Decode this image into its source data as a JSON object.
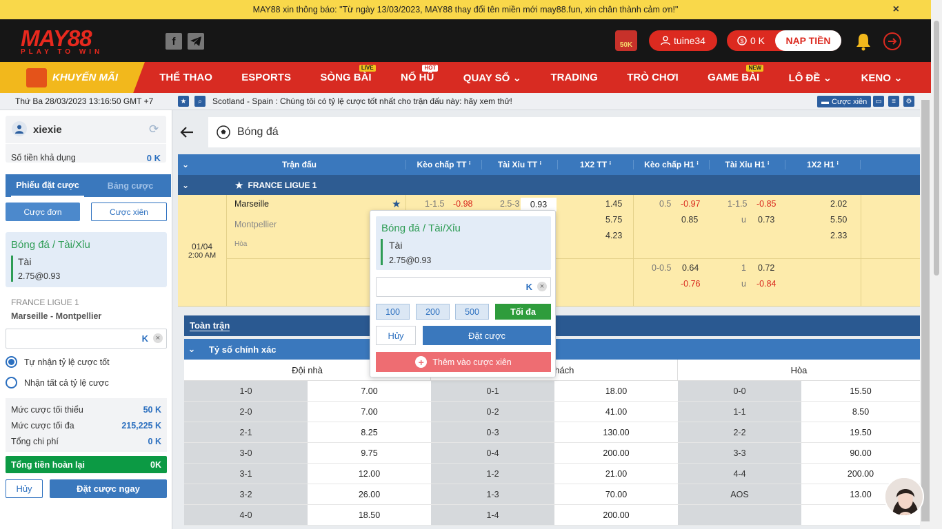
{
  "notice": {
    "text": "MAY88 xin thông báo: \"Từ ngày 13/03/2023, MAY88 thay đổi tên miền mới may88.fun, xin chân thành cảm ơn!\"",
    "close": "×"
  },
  "brand": {
    "name": "MAY88",
    "tagline": "PLAY TO WIN",
    "accent": "#dc2a20"
  },
  "header": {
    "promo_badge": "50K",
    "username": "tuine34",
    "balance": "0 K",
    "deposit_label": "NẠP TIỀN"
  },
  "nav": {
    "promo": "KHUYẾN MÃI",
    "items": [
      {
        "label": "THỂ THAO",
        "badge": ""
      },
      {
        "label": "ESPORTS",
        "badge": ""
      },
      {
        "label": "SÒNG BÀI",
        "badge": "LIVE"
      },
      {
        "label": "NỔ HŨ",
        "badge": "HOT"
      },
      {
        "label": "QUAY SỐ",
        "badge": ""
      },
      {
        "label": "TRADING",
        "badge": ""
      },
      {
        "label": "TRÒ CHƠI",
        "badge": ""
      },
      {
        "label": "GAME BÀI",
        "badge": "NEW"
      },
      {
        "label": "LÔ ĐỀ",
        "badge": ""
      },
      {
        "label": "KENO",
        "badge": ""
      }
    ]
  },
  "infobar": {
    "datetime": "Thứ Ba 28/03/2023 13:16:50 GMT +7",
    "ticker": "Scotland - Spain : Chúng tôi có tỷ lệ cược tốt nhất cho trận đấu này: hãy xem thử!",
    "parlay": "Cược xiên"
  },
  "sidebar": {
    "user": "xiexie",
    "available_label": "Số tiền khả dụng",
    "available_value": "0 K",
    "tab_active": "Phiếu đặt cược",
    "tab_other": "Bảng cược",
    "btn_single": "Cược đơn",
    "btn_parlay": "Cược xiên",
    "bet_market": "Bóng đá / Tài/Xỉu",
    "bet_pick": "Tài",
    "bet_odds": "2.75@0.93",
    "league": "FRANCE LIGUE 1",
    "match": "Marseille - Montpellier",
    "stake_unit": "K",
    "clear": "×",
    "opt1": "Tự nhận tỷ lệ cược tốt",
    "opt2": "Nhận tất cả tỷ lệ cược",
    "min_label": "Mức cược tối thiểu",
    "min_value": "50 K",
    "max_label": "Mức cược tối đa",
    "max_value": "215,225 K",
    "total_label": "Tổng chi phí",
    "total_value": "0 K",
    "refund_label": "Tổng tiền hoàn lại",
    "refund_value": "0K",
    "cancel": "Hủy",
    "place": "Đặt cược ngay"
  },
  "main": {
    "title": "Bóng đá",
    "columns": [
      "Trận đấu",
      "Kèo chấp TT",
      "Tài Xỉu TT",
      "1X2 TT",
      "Kèo chấp H1",
      "Tài Xỉu H1",
      "1X2 H1"
    ],
    "league": "FRANCE LIGUE 1",
    "match": {
      "date": "01/04",
      "time": "2:00 AM",
      "home": "Marseille",
      "away": "Montpellier",
      "draw": "Hòa",
      "hdp_tt_line": "1-1.5",
      "hdp_tt_odds": "-0.98",
      "ou_tt_line": "2.5-3",
      "ou_tt_odds": "0.93",
      "x12_tt": [
        "1.45",
        "5.75",
        "4.23"
      ],
      "hdp_h1_line": "0.5",
      "hdp_h1_odds1": "-0.97",
      "hdp_h1_odds2": "0.85",
      "ou_h1_line": "1-1.5",
      "ou_h1_odds1": "-0.85",
      "ou_h1_u": "u",
      "ou_h1_odds2": "0.73",
      "x12_h1": [
        "2.02",
        "5.50",
        "2.33"
      ],
      "alt_hdp_h1_line": "0-0.5",
      "alt_hdp_h1_odds1": "0.64",
      "alt_hdp_h1_odds2": "-0.76",
      "alt_ou_h1_line": "1",
      "alt_ou_h1_odds1": "0.72",
      "alt_ou_h1_u": "u",
      "alt_ou_h1_odds2": "-0.84"
    },
    "tab_full": "Toàn trận",
    "section": "Tỷ số chính xác",
    "cs_headers": [
      "Đội nhà",
      "Đội khách",
      "Hòa"
    ],
    "cs_rows": [
      [
        "1-0",
        "7.00",
        "0-1",
        "18.00",
        "0-0",
        "15.50"
      ],
      [
        "2-0",
        "7.00",
        "0-2",
        "41.00",
        "1-1",
        "8.50"
      ],
      [
        "2-1",
        "8.25",
        "0-3",
        "130.00",
        "2-2",
        "19.50"
      ],
      [
        "3-0",
        "9.75",
        "0-4",
        "200.00",
        "3-3",
        "90.00"
      ],
      [
        "3-1",
        "12.00",
        "1-2",
        "21.00",
        "4-4",
        "200.00"
      ],
      [
        "3-2",
        "26.00",
        "1-3",
        "70.00",
        "AOS",
        "13.00"
      ],
      [
        "4-0",
        "18.50",
        "1-4",
        "200.00",
        "",
        ""
      ]
    ]
  },
  "popup": {
    "market": "Bóng đá / Tài/Xỉu",
    "pick": "Tài",
    "odds": "2.75@0.93",
    "unit": "K",
    "clear": "×",
    "chips": [
      "100",
      "200",
      "500"
    ],
    "max": "Tối đa",
    "cancel": "Hủy",
    "place": "Đặt cược",
    "add_parlay": "Thêm vào cược xiên"
  }
}
